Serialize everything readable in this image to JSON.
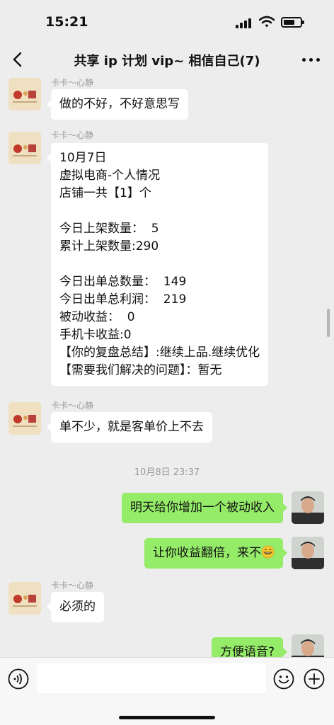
{
  "status_bar": {
    "time": "15:21",
    "icons": [
      "cellular-signal-icon",
      "wifi-icon",
      "battery-icon"
    ]
  },
  "nav": {
    "title": "共享 ip 计划 vip~ 相信自己(7)",
    "back_icon": "chevron-left-icon",
    "more_icon": "more-dots-icon"
  },
  "messages": [
    {
      "side": "left",
      "sender": "卡卡～心静",
      "text": "做的不好，不好意思写"
    },
    {
      "side": "left",
      "sender": "卡卡～心静",
      "text": "10月7日\n虚拟电商-个人情况\n店铺一共【1】个\n\n今日上架数量：  5\n累计上架数量:290\n\n今日出单总数量：  149\n今日出单总利润：  219\n被动收益：  0\n手机卡收益:0\n【你的复盘总结】:继续上品.继续优化\n【需要我们解决的问题】：暂无"
    },
    {
      "side": "left",
      "sender": "卡卡～心静",
      "text": "单不少，就是客单价上不去"
    },
    {
      "type": "timestamp",
      "text": "10月8日 23:37"
    },
    {
      "side": "right",
      "text": "明天给你增加一个被动收入"
    },
    {
      "side": "right",
      "text": "让你收益翻倍，来不",
      "emoji": "grinning-face-emoji"
    },
    {
      "side": "left",
      "sender": "卡卡～心静",
      "text": "必须的"
    },
    {
      "side": "right",
      "text": "方便语音?"
    }
  ],
  "input_bar": {
    "placeholder": "",
    "icons": [
      "voice-icon",
      "emoji-icon",
      "plus-icon"
    ]
  },
  "colors": {
    "background": "#ededed",
    "outgoing_bubble": "#95ec69",
    "incoming_bubble": "#ffffff",
    "meta_text": "#9a9a9a"
  }
}
